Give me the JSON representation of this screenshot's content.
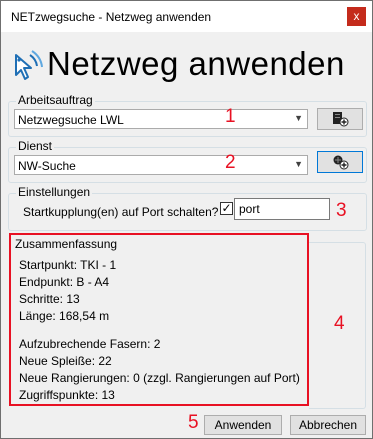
{
  "window": {
    "title": "NETzwegsuche - Netzweg anwenden",
    "close_label": "x",
    "header_title": "Netzweg anwenden",
    "header_icon": "cursor-network-icon"
  },
  "arbeitsauftrag": {
    "legend": "Arbeitsauftrag",
    "value": "Netzwegsuche LWL",
    "marker": "1"
  },
  "dienst": {
    "legend": "Dienst",
    "value": "NW-Suche",
    "marker": "2"
  },
  "einstellungen": {
    "legend": "Einstellungen",
    "label": "Startkupplung(en) auf Port schalten?",
    "checked_glyph": "✓",
    "checked": true,
    "port_value": "port",
    "marker": "3"
  },
  "summary": {
    "legend": "Zusammenfassung",
    "marker": "4",
    "lines": [
      "Startpunkt: TKI - 1",
      "Endpunkt: B - A4",
      "Schritte: 13",
      "Länge: 168,54 m",
      "Aufzubrechende Fasern: 2",
      "Neue Spleiße: 22",
      "Neue Rangierungen: 0 (zzgl. Rangierungen auf Port)",
      "Zugriffspunkte: 13"
    ]
  },
  "footer": {
    "marker": "5",
    "apply_label": "Anwenden",
    "cancel_label": "Abbrechen"
  },
  "colors": {
    "marker_red": "#e81123",
    "close_red": "#c42b1c",
    "focus_blue": "#0078d7"
  }
}
